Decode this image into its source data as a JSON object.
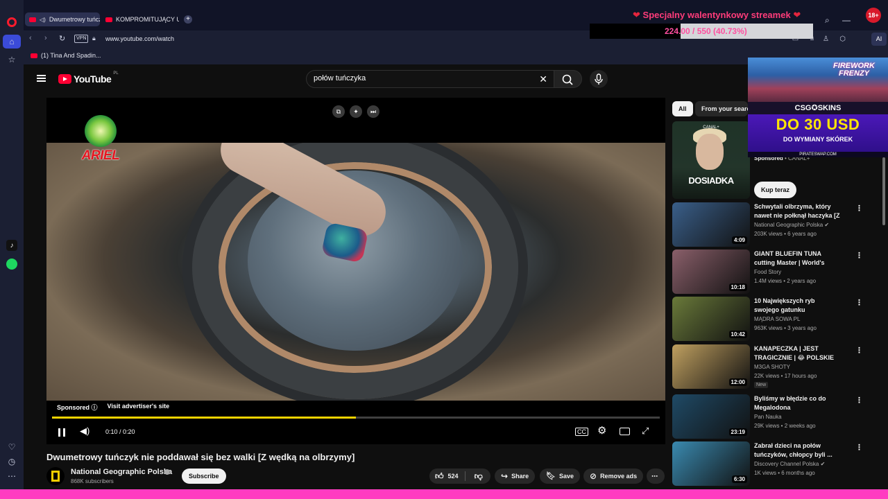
{
  "browser": {
    "tabs": [
      {
        "label": "Dwumetrowy tuńczyk"
      },
      {
        "label": "KOMPROMITUJĄCY UPAD"
      }
    ],
    "new_tab": "+",
    "promo": {
      "text": "Specjalny walentynkowy streamek",
      "counter": "224.00 / 550 (40.73%)",
      "progress": 0.4073
    },
    "badge": "18+",
    "vpn": "VPN",
    "url": "www.youtube.com/watch",
    "ai_label": "AI",
    "bookmark": "(1) Tina And Spadin..."
  },
  "youtube": {
    "logo": "YouTube",
    "region": "PL",
    "search": {
      "value": "połów tuńczyka",
      "placeholder": "Search"
    },
    "player": {
      "ad_brand": "ARIEL",
      "sponsored": "Sponsored",
      "visit": "Visit advertiser's site",
      "time": "0:10 / 0:20",
      "progress": 0.5
    },
    "video": {
      "title": "Dwumetrowy tuńczyk nie poddawał się bez walki [Z wędką na olbrzymy]",
      "channel": "National Geographic Polska",
      "subscribers": "868K subscribers",
      "subscribe": "Subscribe",
      "likes": "524",
      "share": "Share",
      "save": "Save",
      "remove_ads": "Remove ads"
    },
    "chips": {
      "all": "All",
      "from": "From your search"
    },
    "sponsor": {
      "thumb_brand": "CANAL+",
      "thumb_title": "DOSIADKA",
      "label": "Sponsored",
      "channel": "CANAL+",
      "cta": "Kup teraz"
    },
    "recommendations": [
      {
        "title": "Schwytali olbrzyma, który nawet nie połknął haczyka [Z wędką ...",
        "channel": "National Geographic Polska",
        "meta": "203K views • 6 years ago",
        "duration": "4:09",
        "verified": true,
        "color": "#3a5f8a"
      },
      {
        "title": "GIANT BLUEFIN TUNA cutting Master | World's Sharpest Tun...",
        "channel": "Food Story",
        "meta": "1.4M views • 2 years ago",
        "duration": "10:18",
        "verified": false,
        "color": "#8a5f6a"
      },
      {
        "title": "10 Największych ryb swojego gatunku",
        "channel": "MĄDRA SOWA PL",
        "meta": "963K views • 3 years ago",
        "duration": "10:42",
        "verified": false,
        "color": "#6a7a3a"
      },
      {
        "title": "KANAPECZKA | JEST TRAGICZNIE | 😂 POLSKIE ...",
        "channel": "M3GA SHOTY",
        "meta": "22K views • 17 hours ago",
        "duration": "12:00",
        "verified": false,
        "is_new": "New",
        "color": "#c0a060"
      },
      {
        "title": "Byliśmy w błędzie co do Megalodona",
        "channel": "Pan Nauka",
        "meta": "29K views • 2 weeks ago",
        "duration": "23:19",
        "verified": false,
        "color": "#1f4a66"
      },
      {
        "title": "Zabrał dzieci na połów tuńczyków, chłopcy byli ...",
        "channel": "Discovery Channel Polska",
        "meta": "1K views • 6 months ago",
        "duration": "6:30",
        "verified": true,
        "color": "#3a8ab0"
      }
    ]
  },
  "ad_overlay": {
    "title": "FIREWORK FRENZY",
    "brand": "CSG✪SKINS",
    "promo": "DO 30 USD",
    "sub": "DO WYMIANY SKÓREK",
    "url": "PIRATESWAP.COM"
  },
  "colors": {
    "accent_progress": "#f7d300",
    "promo_pink": "#ff3c7a",
    "bottom_bar": "#ff3cc1",
    "youtube_red": "#ff0033"
  }
}
